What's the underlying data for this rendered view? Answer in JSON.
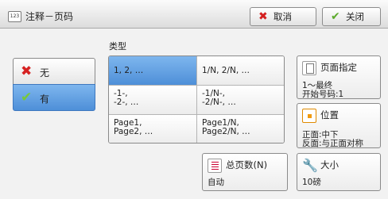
{
  "window": {
    "title": "注释－页码",
    "title_icon_text": "123",
    "cancel_label": "取消",
    "close_label": "关闭",
    "cancel_icon": "red-x-icon",
    "close_icon": "green-check-icon"
  },
  "type_section": {
    "label": "类型"
  },
  "selection": {
    "none_label": "无",
    "yes_label": "有",
    "selected": "有",
    "none_icon": "red-x-icon",
    "yes_icon": "green-check-icon"
  },
  "styles": [
    {
      "line1": "1, 2, …",
      "line2": ""
    },
    {
      "line1": "1/N, 2/N, …",
      "line2": ""
    },
    {
      "line1": "-1-,",
      "line2": "-2-, …"
    },
    {
      "line1": "-1/N-,",
      "line2": "-2/N-, …"
    },
    {
      "line1": "Page1,",
      "line2": "Page2, …"
    },
    {
      "line1": "Page1/N,",
      "line2": "Page2/N, …"
    }
  ],
  "selected_style": "1, 2, …",
  "page_range": {
    "title": "页面指定",
    "line1": "1～最终",
    "line2": "开始号码:1"
  },
  "position": {
    "title": "位置",
    "line1": "正面:中下",
    "line2": "反面:与正面对称"
  },
  "total_pages": {
    "title": "总页数(N)",
    "value": "自动"
  },
  "size": {
    "title": "大小",
    "value": "10磅"
  },
  "colors": {
    "selected_blue": "#5a98dc",
    "cancel_red": "#d42020",
    "check_green": "#5caa2c"
  }
}
